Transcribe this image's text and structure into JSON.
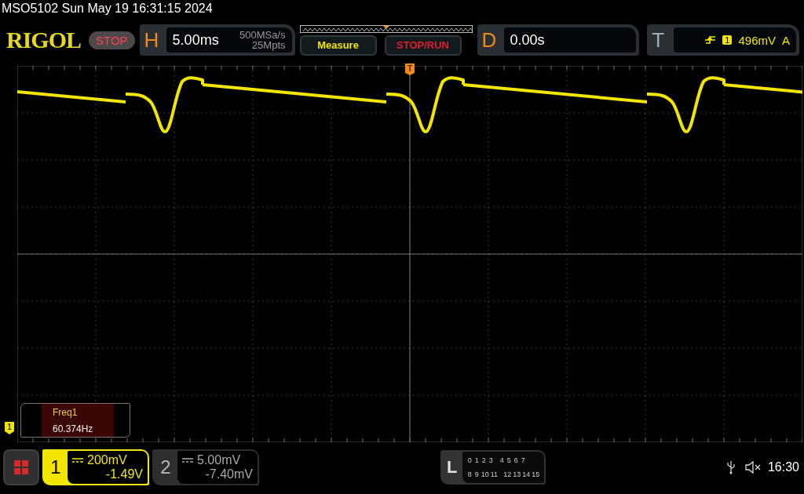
{
  "status_line": "MSO5102  Sun May 19 16:31:15 2024",
  "brand": "RIGOL",
  "run_state": "STOP",
  "horizontal": {
    "label": "H",
    "timebase": "5.00ms",
    "sample_rate": "500MSa/s",
    "memory_depth": "25Mpts"
  },
  "measure_button": "Measure",
  "stop_run_button": "STOP/RUN",
  "delay": {
    "label": "D",
    "value": "0.00s"
  },
  "trigger": {
    "label": "T",
    "source": "1",
    "level": "496mV",
    "mode": "A"
  },
  "trigger_marker": "T",
  "channel_marker": "1",
  "measurement": {
    "name": "Freq1",
    "value": "60.374Hz"
  },
  "channels": [
    {
      "number": "1",
      "scale": "200mV",
      "offset": "-1.49V",
      "selected": true
    },
    {
      "number": "2",
      "scale": "5.00mV",
      "offset": "-7.40mV",
      "selected": false
    }
  ],
  "logic": {
    "label": "L",
    "bits": [
      "0",
      "1",
      "2",
      "3",
      "4",
      "5",
      "6",
      "7",
      "8",
      "9",
      "10",
      "11",
      "12",
      "13",
      "14",
      "15"
    ]
  },
  "clock": "16:30"
}
